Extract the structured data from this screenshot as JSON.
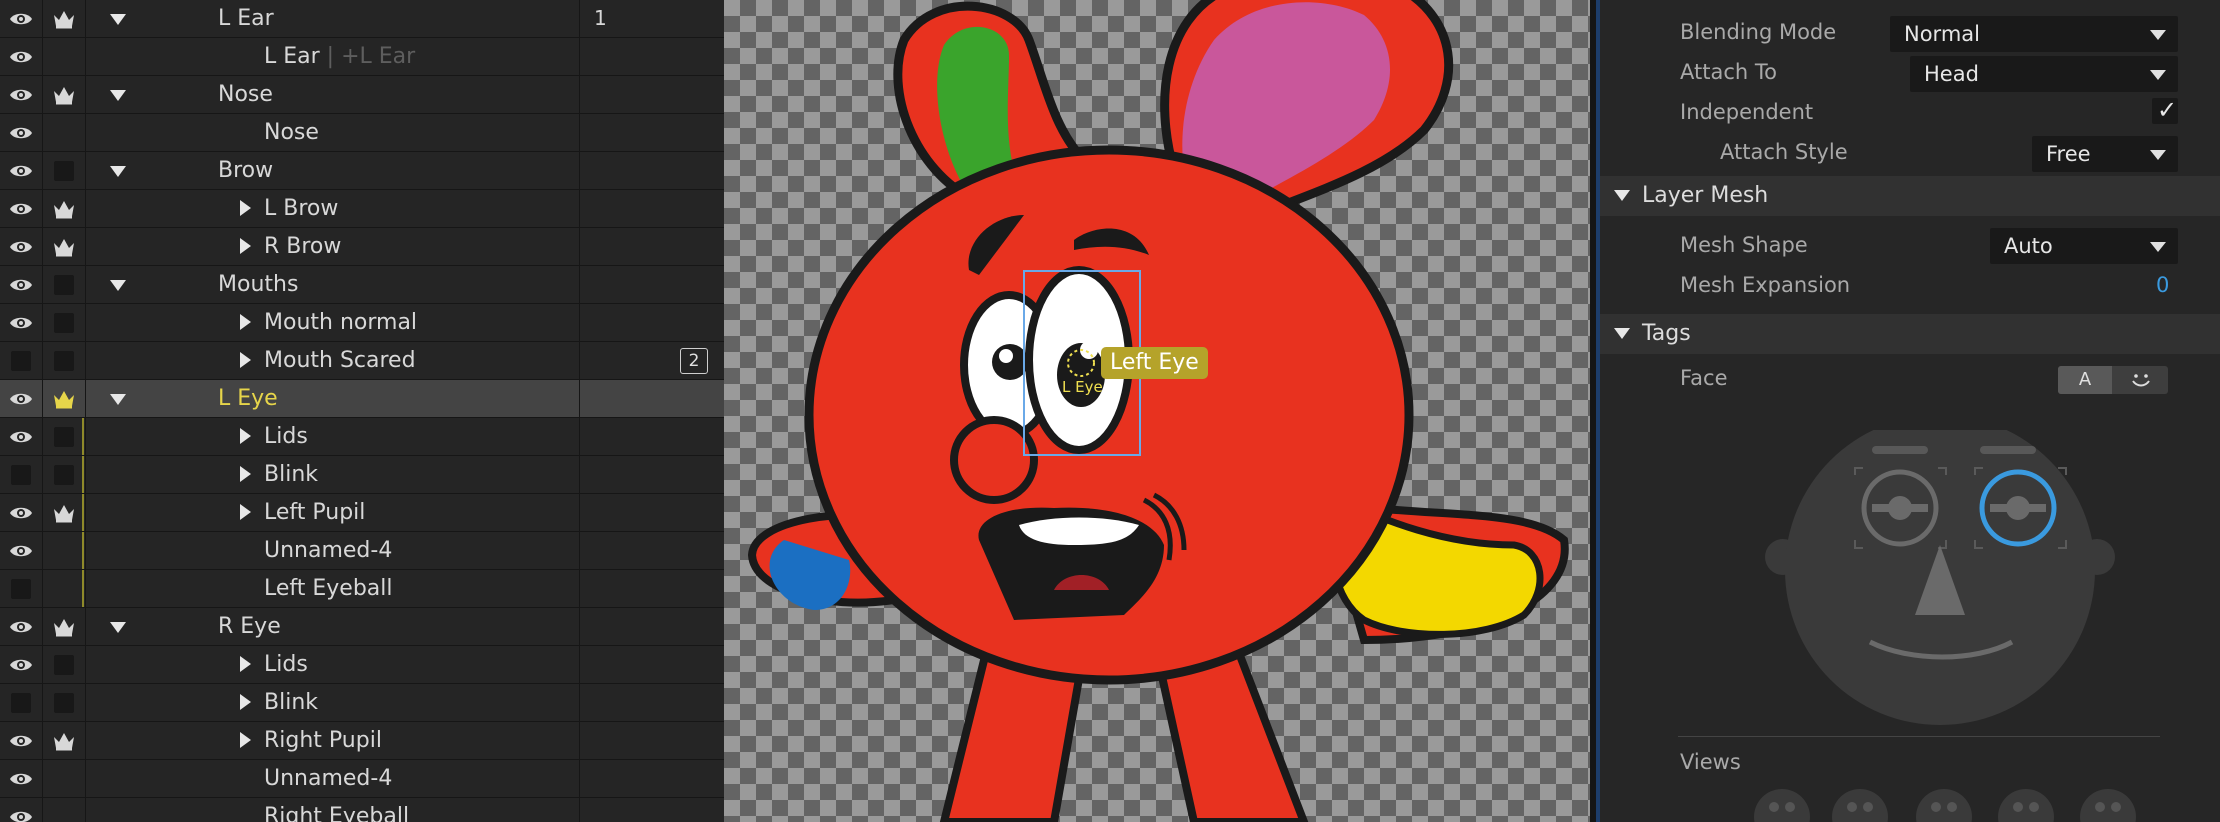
{
  "layers": [
    {
      "name": "L Ear",
      "indent": 1,
      "expander": "down",
      "eye": true,
      "crown": true,
      "extra": "1"
    },
    {
      "name": "L Ear",
      "suffix": " | +L Ear",
      "indent": 2,
      "expander": "none",
      "eye": true,
      "crown": false
    },
    {
      "name": "Nose",
      "indent": 1,
      "expander": "down",
      "eye": true,
      "crown": true
    },
    {
      "name": "Nose",
      "indent": 2,
      "expander": "none",
      "eye": true,
      "crown": false
    },
    {
      "name": "Brow",
      "indent": 1,
      "expander": "down",
      "eye": true,
      "crown": false,
      "box": true
    },
    {
      "name": "L Brow",
      "indent": 2,
      "expander": "right",
      "eye": true,
      "crown": true
    },
    {
      "name": "R Brow",
      "indent": 2,
      "expander": "right",
      "eye": true,
      "crown": true
    },
    {
      "name": "Mouths",
      "indent": 1,
      "expander": "down",
      "eye": true,
      "crown": false,
      "box": true
    },
    {
      "name": "Mouth normal",
      "indent": 2,
      "expander": "right",
      "eye": true,
      "crown": false,
      "box": true
    },
    {
      "name": "Mouth Scared",
      "indent": 2,
      "expander": "right",
      "eye": false,
      "crown": false,
      "box": true,
      "badge": "2"
    },
    {
      "name": "L Eye",
      "indent": 1,
      "expander": "down",
      "eye": true,
      "crown": true,
      "selected": true
    },
    {
      "name": "Lids",
      "indent": 2,
      "expander": "right",
      "eye": true,
      "crown": false,
      "box": true,
      "marker": true
    },
    {
      "name": "Blink",
      "indent": 2,
      "expander": "right",
      "eye": false,
      "crown": false,
      "box": true,
      "marker": true
    },
    {
      "name": "Left Pupil",
      "indent": 2,
      "expander": "right",
      "eye": true,
      "crown": true,
      "marker": true
    },
    {
      "name": "Unnamed-4",
      "indent": 2,
      "expander": "none",
      "eye": true,
      "crown": false,
      "marker": true
    },
    {
      "name": "Left Eyeball",
      "indent": 2,
      "expander": "none",
      "eye": false,
      "crown": false,
      "marker": true
    },
    {
      "name": "R Eye",
      "indent": 1,
      "expander": "down",
      "eye": true,
      "crown": true
    },
    {
      "name": "Lids",
      "indent": 2,
      "expander": "right",
      "eye": true,
      "crown": false,
      "box": true
    },
    {
      "name": "Blink",
      "indent": 2,
      "expander": "right",
      "eye": false,
      "crown": false,
      "box": true
    },
    {
      "name": "Right Pupil",
      "indent": 2,
      "expander": "right",
      "eye": true,
      "crown": true
    },
    {
      "name": "Unnamed-4",
      "indent": 2,
      "expander": "none",
      "eye": true,
      "crown": false
    },
    {
      "name": "Right Eyeball",
      "indent": 2,
      "expander": "none",
      "eye": true,
      "crown": false
    }
  ],
  "canvas": {
    "handle_label": "Left Eye",
    "handle_mini_label": "L Eye"
  },
  "properties": {
    "blending_mode_label": "Blending Mode",
    "blending_mode_value": "Normal",
    "attach_to_label": "Attach To",
    "attach_to_value": "Head",
    "independent_label": "Independent",
    "independent_checked": true,
    "attach_style_label": "Attach Style",
    "attach_style_value": "Free",
    "layer_mesh_title": "Layer Mesh",
    "mesh_shape_label": "Mesh Shape",
    "mesh_shape_value": "Auto",
    "mesh_expansion_label": "Mesh Expansion",
    "mesh_expansion_value": "0",
    "tags_title": "Tags",
    "face_label": "Face",
    "face_mode_a": "A",
    "views_label": "Views"
  },
  "colors": {
    "accent_blue": "#3a9adf",
    "selected_yellow": "#e6d54a",
    "tag_gold": "#b5a32a"
  }
}
